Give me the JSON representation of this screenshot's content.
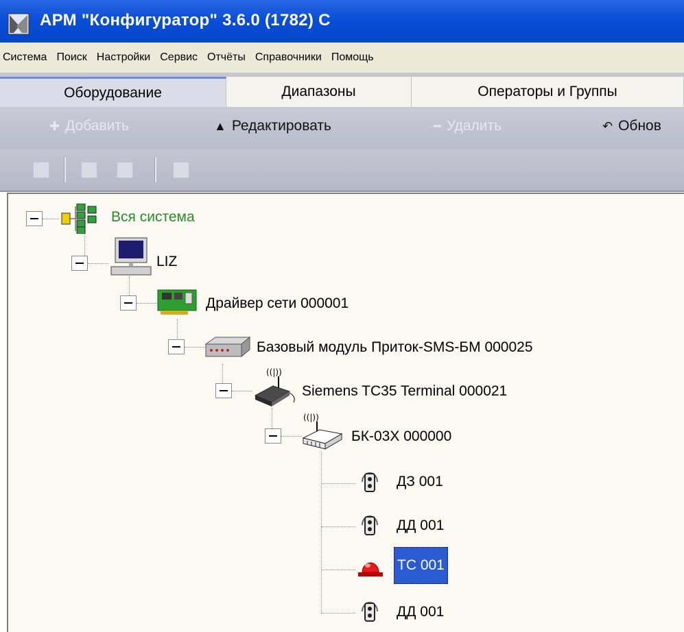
{
  "window": {
    "title": "АРМ \"Конфигуратор\"  3.6.0 (1782) С",
    "icon": "app-icon"
  },
  "menu": {
    "items": [
      "Система",
      "Поиск",
      "Настройки",
      "Сервис",
      "Отчёты",
      "Справочники",
      "Помощь"
    ]
  },
  "tabs": [
    {
      "label": "Оборудование",
      "active": true
    },
    {
      "label": "Диапазоны",
      "active": false
    },
    {
      "label": "Операторы и Группы",
      "active": false
    }
  ],
  "toolbar": {
    "add": {
      "label": "Добавить",
      "icon": "plus-icon",
      "enabled": false
    },
    "edit": {
      "label": "Редактировать",
      "icon": "triangle-up-icon",
      "enabled": true
    },
    "delete": {
      "label": "Удалить",
      "icon": "minus-icon",
      "enabled": false
    },
    "refresh": {
      "label": "Обнов",
      "icon": "undo-icon",
      "enabled": true
    }
  },
  "tree": {
    "root": {
      "label": "Вся система",
      "icon": "network-tree-icon"
    },
    "computer": {
      "label": "LIZ",
      "icon": "computer-icon"
    },
    "driver": {
      "label": "Драйвер сети 000001",
      "icon": "network-card-icon"
    },
    "base_module": {
      "label": "Базовый модуль Приток-SMS-БМ 000025",
      "icon": "module-box-icon"
    },
    "terminal": {
      "label": "Siemens TC35 Terminal 000021",
      "icon": "gsm-terminal-icon"
    },
    "bk": {
      "label": "БК-03Х 000000",
      "icon": "radio-module-icon"
    },
    "sensors": [
      {
        "label": "ДЗ 001",
        "icon": "sensor-icon",
        "selected": false
      },
      {
        "label": "ДД 001",
        "icon": "sensor-icon",
        "selected": false
      },
      {
        "label": "ТС 001",
        "icon": "alarm-lamp-icon",
        "selected": true
      },
      {
        "label": "ДД 001",
        "icon": "sensor-icon",
        "selected": false
      }
    ]
  },
  "colors": {
    "titlebar": "#0a4fd8",
    "selection": "#2a5bd4",
    "root_label": "#2b8a2b",
    "tree_bg": "#fbfaf2"
  }
}
